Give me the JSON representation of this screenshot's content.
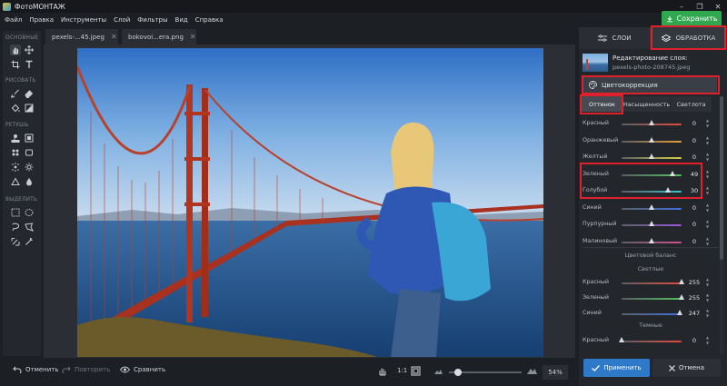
{
  "window": {
    "title": "ФотоМОНТАЖ",
    "controls": [
      "–",
      "❐",
      "✕"
    ]
  },
  "menu": [
    "Файл",
    "Правка",
    "Инструменты",
    "Слой",
    "Фильтры",
    "Вид",
    "Справка"
  ],
  "save_label": "Сохранить",
  "tools": {
    "sections": [
      "ОСНОВНЫЕ",
      "РИСОВАТЬ",
      "РЕТУШЬ",
      "ВЫДЕЛИТЬ"
    ]
  },
  "tabs": [
    {
      "label": "pexels-...45.jpeg"
    },
    {
      "label": "bokovoi...era.png"
    }
  ],
  "bottom": {
    "undo": "Отменить",
    "redo": "Повторить",
    "compare": "Сравнить",
    "fit": "1:1",
    "zoom": "54%",
    "zoom_level": 0.08
  },
  "panel": {
    "tab_layers": "СЛОИ",
    "tab_process": "ОБРАБОТКА",
    "layer_title": "Редактирование слоя:",
    "layer_file": "pexels-photo-208745.jpeg",
    "section": "Цветокоррекция",
    "subtabs": [
      "Оттенок",
      "Насыщенность",
      "Светлота"
    ],
    "hue_sliders": [
      {
        "label": "Красный",
        "value": "0",
        "knob": 0.5,
        "color": "#e24a3b"
      },
      {
        "label": "Оранжевый",
        "value": "0",
        "knob": 0.5,
        "color": "#e89a3c"
      },
      {
        "label": "Желтый",
        "value": "0",
        "knob": 0.5,
        "color": "#d8d040"
      },
      {
        "label": "Зеленый",
        "value": "49",
        "knob": 0.85,
        "color": "#4fc35a"
      },
      {
        "label": "Голубой",
        "value": "30",
        "knob": 0.77,
        "color": "#3cc3c8"
      },
      {
        "label": "Синий",
        "value": "0",
        "knob": 0.5,
        "color": "#3f70e0"
      },
      {
        "label": "Пурпурный",
        "value": "0",
        "knob": 0.5,
        "color": "#9e55d8"
      },
      {
        "label": "Малиновый",
        "value": "0",
        "knob": 0.5,
        "color": "#d1508f"
      }
    ],
    "balance_title": "Цветовой баланс",
    "balance_light": "Светлые",
    "balance_light_sliders": [
      {
        "label": "Красный",
        "value": "255",
        "knob": 1.0,
        "color": "#e24a3b"
      },
      {
        "label": "Зеленый",
        "value": "255",
        "knob": 1.0,
        "color": "#4fc35a"
      },
      {
        "label": "Синий",
        "value": "247",
        "knob": 0.97,
        "color": "#3f70e0"
      }
    ],
    "balance_dark": "Темные",
    "balance_dark_sliders": [
      {
        "label": "Красный",
        "value": "0",
        "knob": 0.0,
        "color": "#e24a3b"
      }
    ],
    "apply": "Применить",
    "cancel": "Отмена"
  }
}
